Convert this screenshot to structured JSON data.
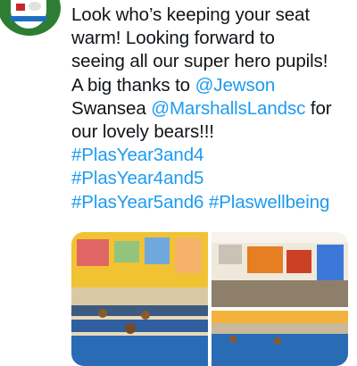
{
  "tweet": {
    "lines": [
      [
        {
          "t": "Look who’s keeping your seat",
          "k": "text"
        }
      ],
      [
        {
          "t": "warm! Looking forward to",
          "k": "text"
        }
      ],
      [
        {
          "t": "seeing all our super hero pupils!",
          "k": "text"
        }
      ],
      [
        {
          "t": "A big thanks to ",
          "k": "text"
        },
        {
          "t": "@Jewson",
          "k": "mention"
        }
      ],
      [
        {
          "t": "Swansea ",
          "k": "text"
        },
        {
          "t": "@MarshallsLandsc",
          "k": "mention"
        },
        {
          "t": " for",
          "k": "text"
        }
      ],
      [
        {
          "t": "our lovely bears!!!",
          "k": "text"
        }
      ],
      [
        {
          "t": "#PlasYear3and4",
          "k": "hashtag"
        }
      ],
      [
        {
          "t": "#PlasYear4and5",
          "k": "hashtag"
        }
      ],
      [
        {
          "t": "#PlasYear5and6 ",
          "k": "hashtag"
        },
        {
          "t": "#Plaswellbeing",
          "k": "hashtag"
        }
      ]
    ]
  },
  "colors": {
    "link": "#1d9bf0",
    "text": "#0f1419",
    "avatar_green": "#2e7d32"
  },
  "icons": {
    "avatar": "school-crest-icon"
  }
}
